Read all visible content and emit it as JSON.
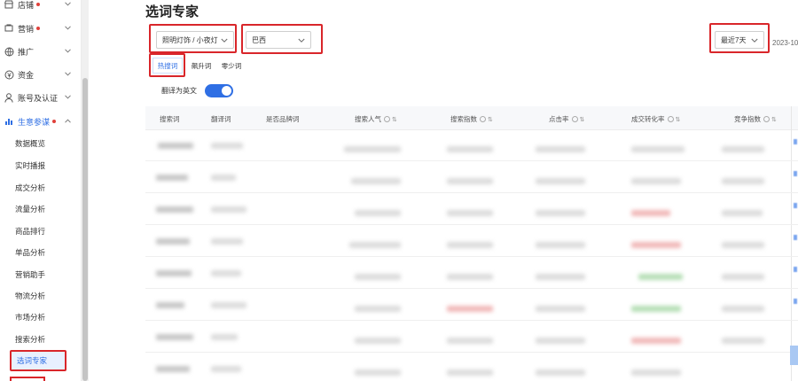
{
  "sidebar": {
    "items": [
      {
        "label": "店铺",
        "icon": "shop-icon",
        "dot": true
      },
      {
        "label": "营销",
        "icon": "marketing-icon",
        "dot": true
      },
      {
        "label": "推广",
        "icon": "globe-icon",
        "dot": false
      },
      {
        "label": "资金",
        "icon": "coin-icon",
        "dot": false
      },
      {
        "label": "账号及认证",
        "icon": "user-icon",
        "dot": false
      },
      {
        "label": "生意参谋",
        "icon": "chart-icon",
        "dot": true
      }
    ],
    "sub_items": [
      "数据概览",
      "实时播报",
      "成交分析",
      "流量分析",
      "商品排行",
      "单品分析",
      "营销助手",
      "物流分析",
      "市场分析",
      "搜索分析",
      "选词专家"
    ]
  },
  "page": {
    "title": "选词专家"
  },
  "filters": {
    "category": "照明灯饰 / 小夜灯",
    "country": "巴西",
    "period": "最近7天",
    "date_text": "2023-10-"
  },
  "tabs": [
    "热搜词",
    "飙升词",
    "零少词"
  ],
  "translate": {
    "label": "翻译为英文",
    "on": true
  },
  "table": {
    "headers": [
      "搜索词",
      "翻译词",
      "是否品牌词",
      "搜索人气",
      "搜索指数",
      "点击率",
      "成交转化率",
      "竞争指数"
    ]
  },
  "colors": {
    "accent": "#2f6fe4",
    "highlight": "#d9262a",
    "badge": "#e0403a"
  }
}
